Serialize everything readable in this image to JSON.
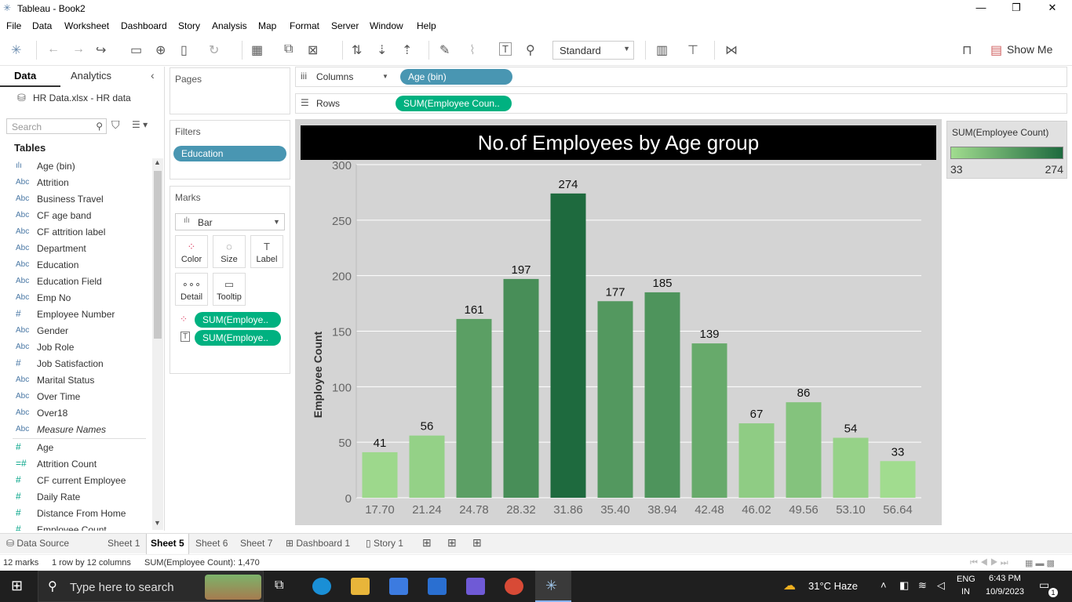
{
  "window": {
    "title": "Tableau - Book2",
    "minimize": "—",
    "maximize": "❐",
    "close": "✕"
  },
  "menu": [
    "File",
    "Data",
    "Worksheet",
    "Dashboard",
    "Story",
    "Analysis",
    "Map",
    "Format",
    "Server",
    "Window",
    "Help"
  ],
  "toolbar": {
    "fit_mode": "Standard",
    "show_me": "Show Me"
  },
  "data_pane": {
    "tabs": [
      "Data",
      "Analytics"
    ],
    "datasource": "HR Data.xlsx - HR data",
    "search_placeholder": "Search",
    "tables_heading": "Tables",
    "dimensions": [
      {
        "type": "ılı",
        "name": "Age (bin)"
      },
      {
        "type": "Abc",
        "name": "Attrition"
      },
      {
        "type": "Abc",
        "name": "Business Travel"
      },
      {
        "type": "Abc",
        "name": "CF age band"
      },
      {
        "type": "Abc",
        "name": "CF attrition label"
      },
      {
        "type": "Abc",
        "name": "Department"
      },
      {
        "type": "Abc",
        "name": "Education"
      },
      {
        "type": "Abc",
        "name": "Education Field"
      },
      {
        "type": "Abc",
        "name": "Emp No"
      },
      {
        "type": "#",
        "name": "Employee Number"
      },
      {
        "type": "Abc",
        "name": "Gender"
      },
      {
        "type": "Abc",
        "name": "Job Role"
      },
      {
        "type": "#",
        "name": "Job Satisfaction"
      },
      {
        "type": "Abc",
        "name": "Marital Status"
      },
      {
        "type": "Abc",
        "name": "Over Time"
      },
      {
        "type": "Abc",
        "name": "Over18"
      },
      {
        "type": "Abc",
        "name": "Measure Names"
      }
    ],
    "measures": [
      {
        "type": "#",
        "name": "Age"
      },
      {
        "type": "=#",
        "name": "Attrition Count"
      },
      {
        "type": "#",
        "name": "CF current Employee"
      },
      {
        "type": "#",
        "name": "Daily Rate"
      },
      {
        "type": "#",
        "name": "Distance From Home"
      },
      {
        "type": "#",
        "name": "Employee Count"
      }
    ]
  },
  "cards": {
    "pages": "Pages",
    "filters": "Filters",
    "filter_pill": "Education",
    "marks": "Marks",
    "mark_type": "Bar",
    "mark_buttons": [
      "Color",
      "Size",
      "Label",
      "Detail",
      "Tooltip"
    ],
    "mark_pills": [
      "SUM(Employe..",
      "SUM(Employe.."
    ]
  },
  "shelves": {
    "columns_label": "Columns",
    "columns_pill": "Age (bin)",
    "rows_label": "Rows",
    "rows_pill": "SUM(Employee Coun.."
  },
  "legend": {
    "title": "SUM(Employee Count)",
    "min": "33",
    "max": "274"
  },
  "chart_data": {
    "type": "bar",
    "title": "No.of Employees by Age group",
    "xlabel": "",
    "ylabel": "Employee Count",
    "categories": [
      "17.70",
      "21.24",
      "24.78",
      "28.32",
      "31.86",
      "35.40",
      "38.94",
      "42.48",
      "46.02",
      "49.56",
      "53.10",
      "56.64"
    ],
    "values": [
      41,
      56,
      161,
      197,
      274,
      177,
      185,
      139,
      67,
      86,
      54,
      33
    ],
    "ylim": [
      0,
      300
    ],
    "yticks": [
      0,
      50,
      100,
      150,
      200,
      250,
      300
    ],
    "color_range": [
      "#a1dc8f",
      "#1e6a3e"
    ],
    "grid": true
  },
  "sheet_tabs": [
    "Data Source",
    "Sheet 1",
    "Sheet 5",
    "Sheet 6",
    "Sheet 7",
    "Dashboard 1",
    "Story 1"
  ],
  "active_tab": "Sheet 5",
  "status": {
    "marks": "12 marks",
    "rowscols": "1 row by 12 columns",
    "sum": "SUM(Employee Count): 1,470"
  },
  "taskbar": {
    "search_placeholder": "Type here to search",
    "weather": "31°C  Haze",
    "lang1": "ENG",
    "lang2": "IN",
    "time": "6:43 PM",
    "date": "10/9/2023",
    "notif": "1"
  }
}
